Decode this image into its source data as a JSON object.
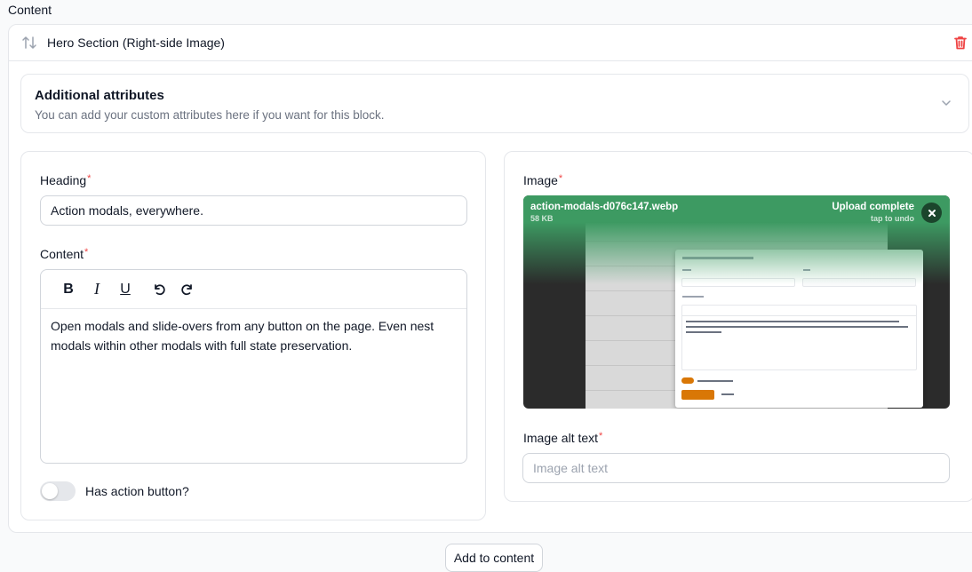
{
  "section_label": "Content",
  "block": {
    "title": "Hero Section (Right-side Image)"
  },
  "attributes": {
    "title": "Additional attributes",
    "description": "You can add your custom attributes here if you want for this block."
  },
  "form": {
    "heading_label": "Heading",
    "heading_value": "Action modals, everywhere.",
    "content_label": "Content",
    "content_value": "Open modals and slide-overs from any button on the page. Even nest modals within other modals with full state preservation.",
    "toolbar": {
      "bold": "B",
      "italic": "I",
      "underline": "U"
    },
    "toggle_label": "Has action button?",
    "toggle_on": false,
    "required_mark": "*",
    "image_label": "Image",
    "upload": {
      "file_name": "action-modals-d076c147.webp",
      "file_size": "58 KB",
      "status": "Upload complete",
      "hint": "tap to undo"
    },
    "alt_label": "Image alt text",
    "alt_placeholder": "Image alt text"
  },
  "add_button": "Add to content",
  "colors": {
    "danger": "#ef4444",
    "upload_success": "#3d9a62",
    "modal_primary": "#d97706"
  },
  "icons": [
    "sort-icon",
    "trash-icon",
    "chevron-down-icon",
    "bold-icon",
    "italic-icon",
    "underline-icon",
    "undo-icon",
    "redo-icon",
    "close-icon"
  ]
}
